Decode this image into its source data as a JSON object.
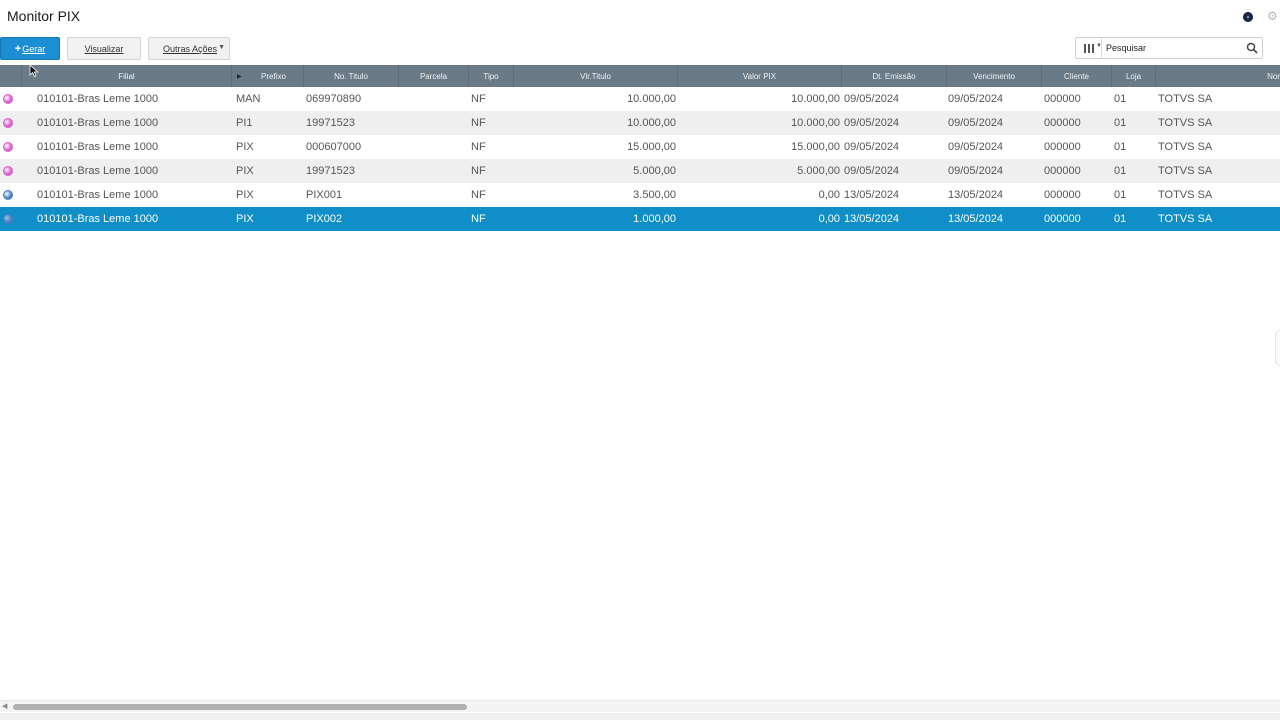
{
  "header": {
    "title": "Monitor PIX",
    "status_color": "#1e2a4a"
  },
  "toolbar": {
    "gerar_label": "Gerar",
    "visualizar_label": "Visualizar",
    "outras_label": "Outras Ações",
    "search_placeholder": "Pesquisar",
    "primary_color": "#1b8fd1"
  },
  "table": {
    "columns": [
      "Filial",
      "Prefixo",
      "No. Titulo",
      "Parcela",
      "Tipo",
      "Vlr.Titulo",
      "Valor PIX",
      "Dt. Emissão",
      "Vencimento",
      "Cliente",
      "Loja",
      "Nor"
    ],
    "rows": [
      {
        "status": "pink",
        "filial": "010101-Bras Leme 1000",
        "prefixo": "MAN",
        "titulo": "069970890",
        "parcela": "",
        "tipo": "NF",
        "vlr_titulo": "10.000,00",
        "valor_pix": "10.000,00",
        "emissao": "09/05/2024",
        "vencimento": "09/05/2024",
        "cliente": "000000",
        "loja": "01",
        "nome": "TOTVS SA"
      },
      {
        "status": "pink",
        "filial": "010101-Bras Leme 1000",
        "prefixo": "PI1",
        "titulo": "19971523",
        "parcela": "",
        "tipo": "NF",
        "vlr_titulo": "10.000,00",
        "valor_pix": "10.000,00",
        "emissao": "09/05/2024",
        "vencimento": "09/05/2024",
        "cliente": "000000",
        "loja": "01",
        "nome": "TOTVS SA"
      },
      {
        "status": "pink",
        "filial": "010101-Bras Leme 1000",
        "prefixo": "PIX",
        "titulo": "000607000",
        "parcela": "",
        "tipo": "NF",
        "vlr_titulo": "15.000,00",
        "valor_pix": "15.000,00",
        "emissao": "09/05/2024",
        "vencimento": "09/05/2024",
        "cliente": "000000",
        "loja": "01",
        "nome": "TOTVS SA"
      },
      {
        "status": "pink",
        "filial": "010101-Bras Leme 1000",
        "prefixo": "PIX",
        "titulo": "19971523",
        "parcela": "",
        "tipo": "NF",
        "vlr_titulo": "5.000,00",
        "valor_pix": "5.000,00",
        "emissao": "09/05/2024",
        "vencimento": "09/05/2024",
        "cliente": "000000",
        "loja": "01",
        "nome": "TOTVS SA"
      },
      {
        "status": "blue",
        "filial": "010101-Bras Leme 1000",
        "prefixo": "PIX",
        "titulo": "PIX001",
        "parcela": "",
        "tipo": "NF",
        "vlr_titulo": "3.500,00",
        "valor_pix": "0,00",
        "emissao": "13/05/2024",
        "vencimento": "13/05/2024",
        "cliente": "000000",
        "loja": "01",
        "nome": "TOTVS SA"
      },
      {
        "status": "blue",
        "filial": "010101-Bras Leme 1000",
        "prefixo": "PIX",
        "titulo": "PIX002",
        "parcela": "",
        "tipo": "NF",
        "vlr_titulo": "1.000,00",
        "valor_pix": "0,00",
        "emissao": "13/05/2024",
        "vencimento": "13/05/2024",
        "cliente": "000000",
        "loja": "01",
        "nome": "TOTVS SA"
      }
    ],
    "selected_row": 5,
    "status_colors": {
      "pink": "#d65fd0",
      "blue": "#4a7fc1"
    },
    "header_color": "#6b7a87",
    "selected_color": "#0f8ec7"
  }
}
